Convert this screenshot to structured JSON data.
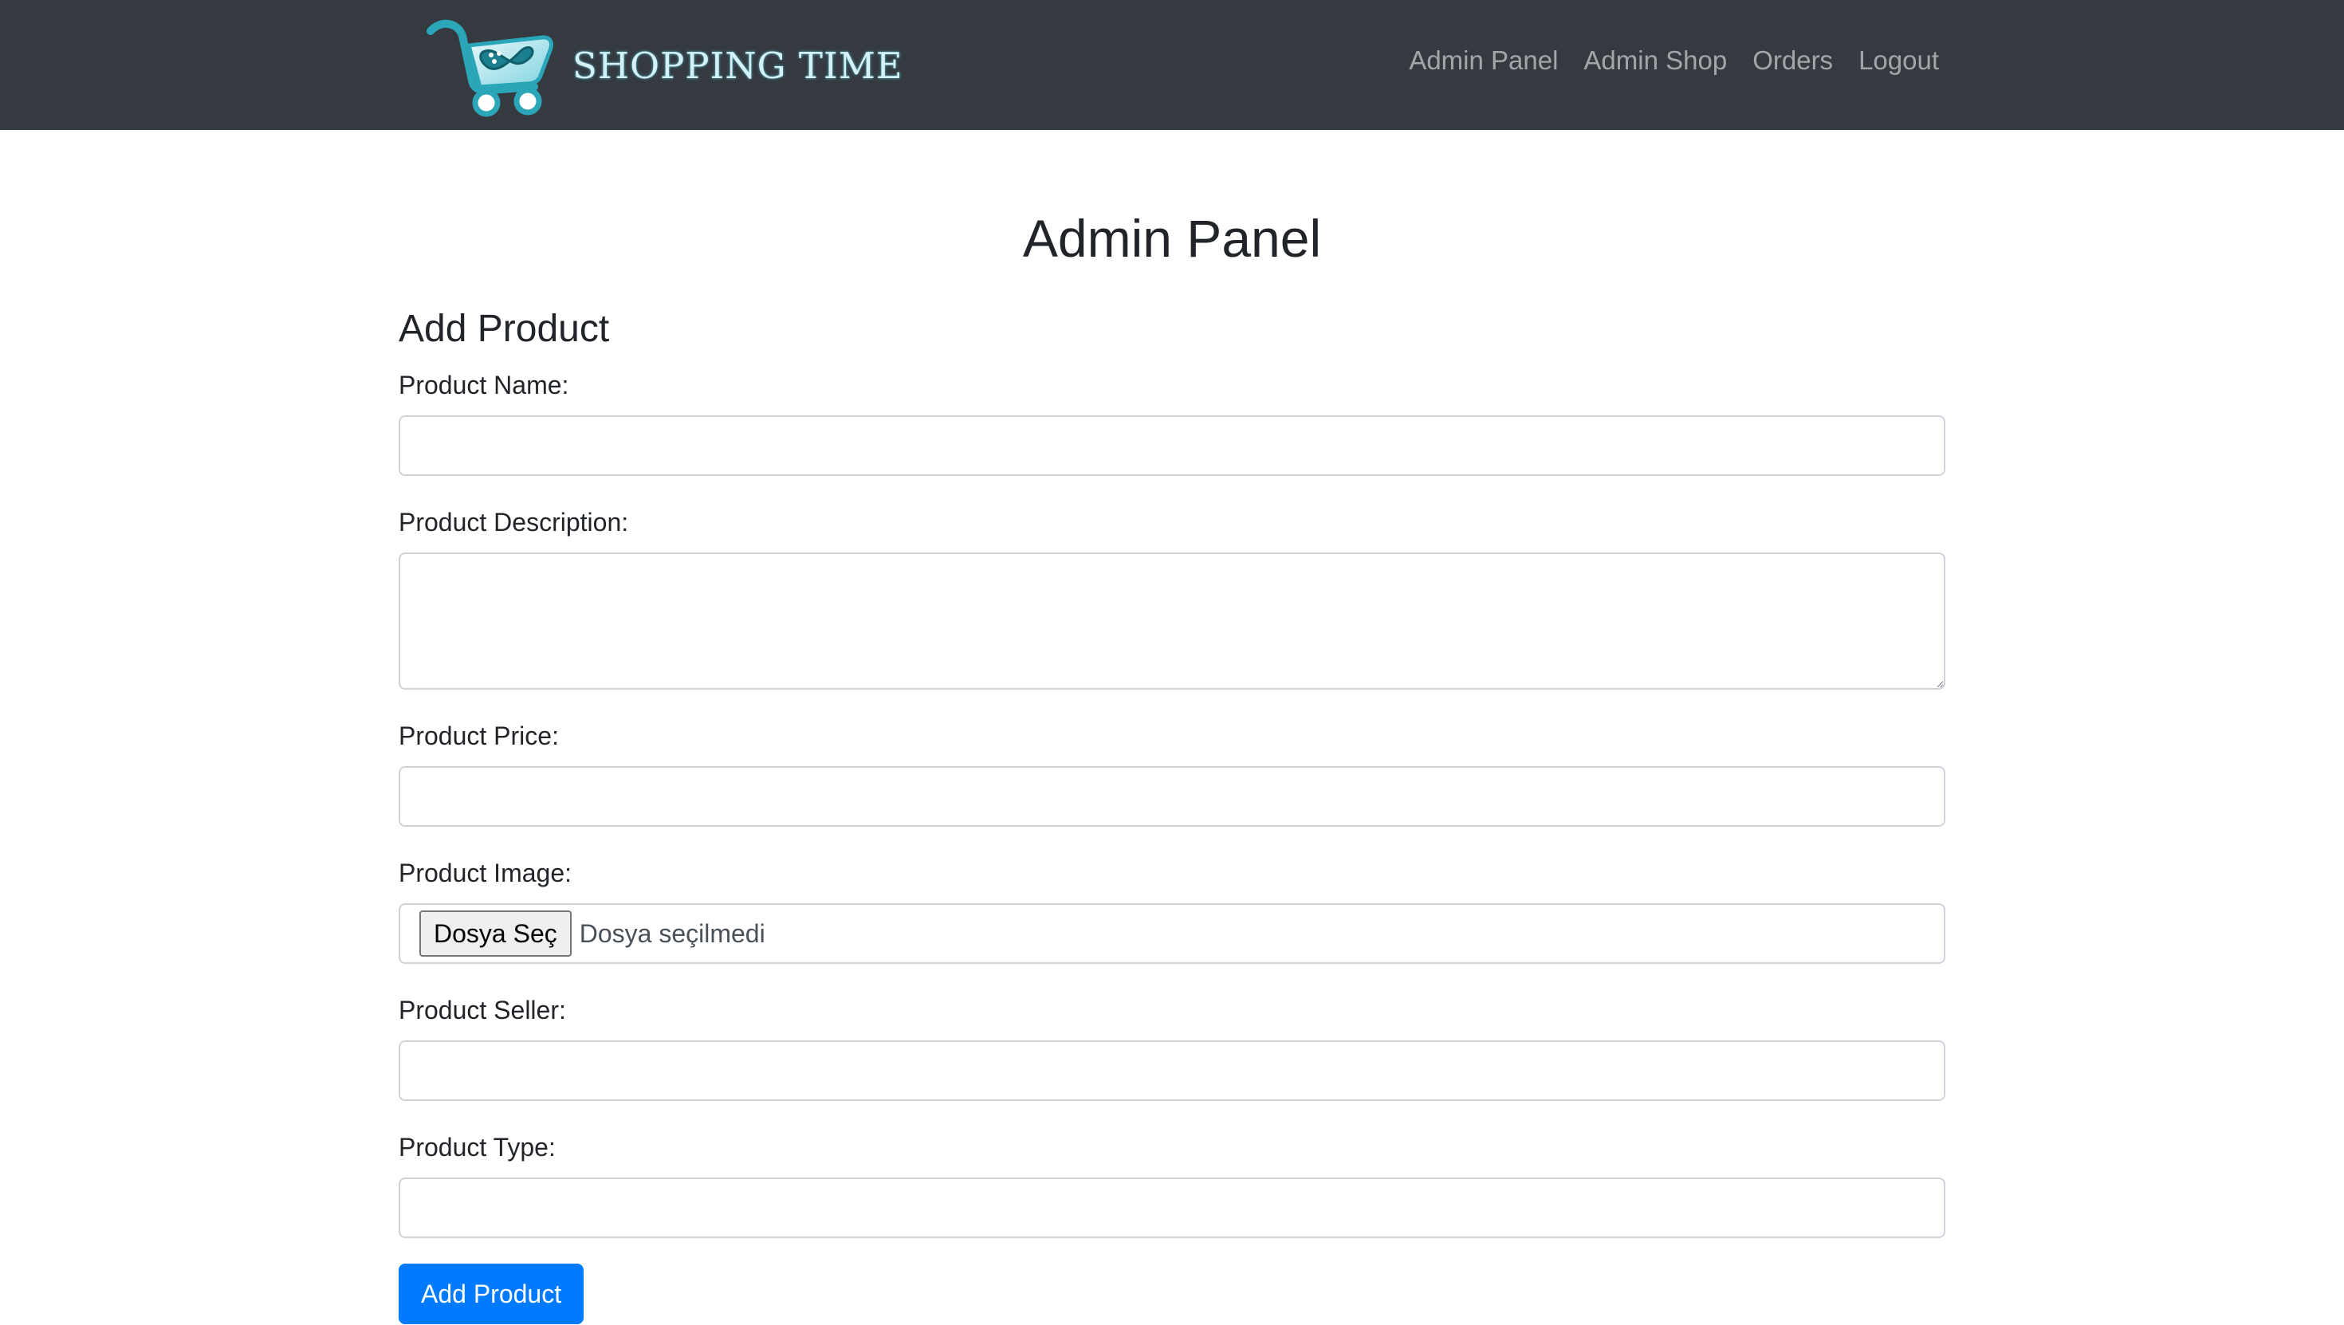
{
  "brand": {
    "name": "SHOPPING TIME",
    "logo_icon": "shopping-cart-logo-icon",
    "logo_color": "#2aa6b8"
  },
  "nav": {
    "links": [
      {
        "label": "Admin Panel"
      },
      {
        "label": "Admin Shop"
      },
      {
        "label": "Orders"
      },
      {
        "label": "Logout"
      }
    ]
  },
  "page": {
    "title": "Admin Panel",
    "section_title": "Add Product"
  },
  "form": {
    "name_label": "Product Name:",
    "name_value": "",
    "description_label": "Product Description:",
    "description_value": "",
    "price_label": "Product Price:",
    "price_value": "",
    "image_label": "Product Image:",
    "image_button": "Dosya Seç",
    "image_status": "Dosya seçilmedi",
    "seller_label": "Product Seller:",
    "seller_value": "",
    "type_label": "Product Type:",
    "type_value": "",
    "submit_label": "Add Product"
  },
  "colors": {
    "navbar": "#343a40",
    "primary": "#007bff",
    "brand_text": "#d5f1f6"
  }
}
